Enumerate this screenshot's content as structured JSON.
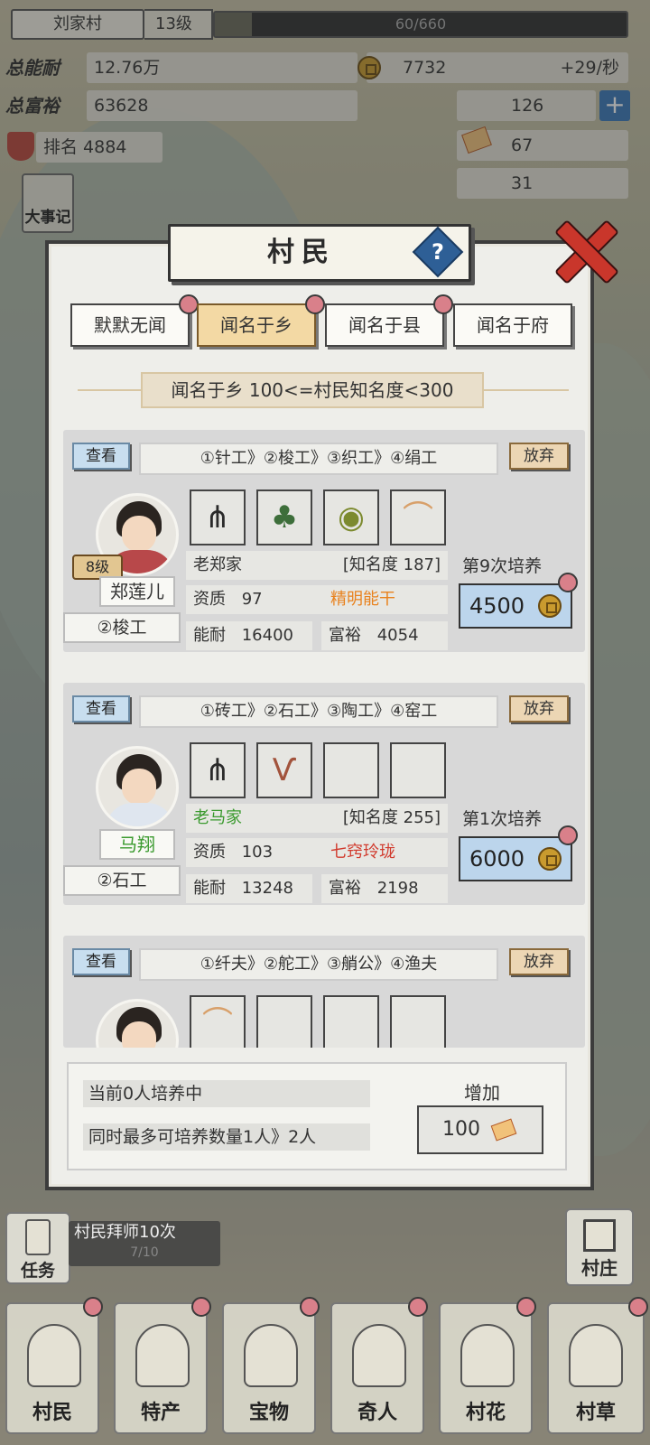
{
  "hud": {
    "village_name": "刘家村",
    "level": "13级",
    "exp": "60/660",
    "exp_fraction": 0.09,
    "power_label": "总能耐",
    "power_value": "12.76万",
    "wealth_label": "总富裕",
    "wealth_value": "63628",
    "rank": "排名 4884",
    "coins": "7732",
    "coins_rate": "+29/秒",
    "resource_2": "126",
    "resource_3": "67",
    "resource_4": "31"
  },
  "side_left": {
    "events": "大事记"
  },
  "dialog": {
    "title": "村民",
    "help_symbol": "?",
    "tabs": [
      "默默无闻",
      "闻名于乡",
      "闻名于县",
      "闻名于府"
    ],
    "active_tab": 1,
    "range_text": "闻名于乡  100<=村民知名度<300",
    "view_label": "查看",
    "quit_label": "放弃",
    "villagers": [
      {
        "level": "8级",
        "name": "郑莲儿",
        "job": "②梭工",
        "path": "①针工》②梭工》③织工》④绢工",
        "family": "老郑家",
        "fame": "[知名度 187]",
        "aptitude_label": "资质",
        "aptitude": "97",
        "trait": "精明能干",
        "ability_label": "能耐",
        "ability": "16400",
        "wealth_label": "富裕",
        "wealth": "4054",
        "train_count": "第9次培养",
        "train_cost": "4500",
        "items": [
          "rake-icon",
          "weed-icon",
          "basket-icon",
          "scale-icon"
        ]
      },
      {
        "level": "",
        "name": "马翔",
        "job": "②石工",
        "path": "①砖工》②石工》③陶工》④窑工",
        "family": "老马家",
        "fame": "[知名度 255]",
        "aptitude_label": "资质",
        "aptitude": "103",
        "trait": "七窍玲珑",
        "ability_label": "能耐",
        "ability": "13248",
        "wealth_label": "富裕",
        "wealth": "2198",
        "train_count": "第1次培养",
        "train_cost": "6000",
        "items": [
          "rake-icon",
          "slingshot-icon",
          "",
          ""
        ]
      },
      {
        "path": "①纤夫》②舵工》③艄公》④渔夫",
        "items": [
          "scale-icon",
          "",
          "",
          ""
        ]
      }
    ],
    "status_line_1": "当前0人培养中",
    "status_line_2": "同时最多可培养数量1人》2人",
    "add_label": "增加",
    "add_cost": "100"
  },
  "bottom": {
    "quest_label": "任务",
    "quest_text": "村民拜师10次",
    "quest_progress": "7/10",
    "village_label": "村庄",
    "nav": [
      "村民",
      "特产",
      "宝物",
      "奇人",
      "村花",
      "村草"
    ]
  },
  "colors": {
    "trait_good": "#e8821e",
    "trait_great": "#d13b2e",
    "name_green": "#3a9a2e",
    "tab_active": "#f3d9a4"
  }
}
